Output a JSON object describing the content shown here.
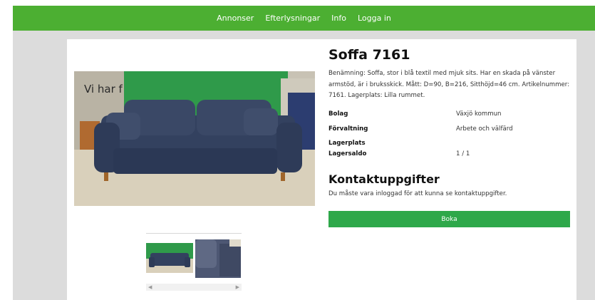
{
  "nav": {
    "items": [
      "Annonser",
      "Efterlysningar",
      "Info",
      "Logga in"
    ]
  },
  "product": {
    "title": "Soffa 7161",
    "description": "Benämning: Soffa, stor i blå textil med mjuk sits. Har en skada på vänster armstöd, är i bruksskick. Mått: D=90, B=216, Sitthöjd=46 cm. Artikelnummer: 7161. Lagerplats: Lilla rummet.",
    "image_sign_text": "Vi har f",
    "properties": [
      {
        "label": "Bolag",
        "value": "Växjö kommun"
      },
      {
        "label": "Förvaltning",
        "value": "Arbete och välfärd"
      },
      {
        "label": "Lagerplats",
        "value": ""
      },
      {
        "label": "Lagersaldo",
        "value": "1 / 1"
      }
    ]
  },
  "contact": {
    "title": "Kontaktuppgifter",
    "message": "Du måste vara inloggad för att kunna se kontaktuppgifter."
  },
  "actions": {
    "book_label": "Boka"
  },
  "colors": {
    "nav_bg": "#4caf32",
    "button_bg": "#2ea84a",
    "page_bg": "#dcdcdc"
  }
}
